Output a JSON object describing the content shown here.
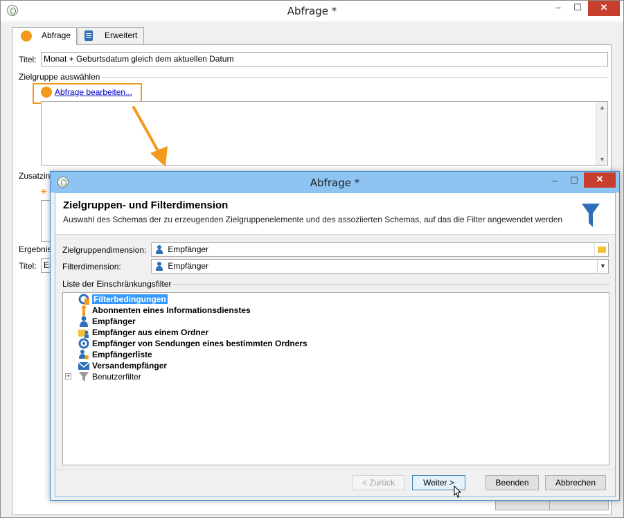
{
  "outer_window": {
    "title": "Abfrage *",
    "minimize_glyph": "–",
    "maximize_glyph": "☐",
    "close_glyph": "✕",
    "tabs": [
      {
        "label": "Abfrage",
        "icon": "orange-circle-icon"
      },
      {
        "label": "Erweitert",
        "icon": "clipboard-icon"
      }
    ],
    "title_label": "Titel:",
    "title_value": "Monat + Geburtsdatum gleich dem aktuellen Datum",
    "section_target": "Zielgruppe auswählen",
    "edit_query_link": "Abfrage bearbeiten...",
    "section_additional_partial": "Zusatzin",
    "section_result_partial": "Ergebnis",
    "title2_label": "Titel:",
    "title2_value_partial": "Er",
    "highlight_color": "#f39a1c"
  },
  "dialog": {
    "title": "Abfrage *",
    "minimize_glyph": "–",
    "maximize_glyph": "☐",
    "close_glyph": "✕",
    "heading": "Zielgruppen- und Filterdimension",
    "subheading": "Auswahl des Schemas der zu erzeugenden Zielgruppenelemente und des assoziierten Schemas, auf das die Filter angewendet werden",
    "target_dimension_label": "Zielgruppendimension:",
    "target_dimension_value": "Empfänger",
    "filter_dimension_label": "Filterdimension:",
    "filter_dimension_value": "Empfänger",
    "filter_list_label": "Liste der Einschränkungsfilter",
    "filter_items": [
      {
        "label": "Filterbedingungen",
        "icon": "filter-conditions-icon",
        "selected": true
      },
      {
        "label": "Abonnenten eines Informationsdienstes",
        "icon": "subscriber-icon"
      },
      {
        "label": "Empfänger",
        "icon": "person-icon"
      },
      {
        "label": "Empfänger aus einem Ordner",
        "icon": "folder-person-icon"
      },
      {
        "label": "Empfänger von Sendungen eines bestimmten Ordners",
        "icon": "delivery-recipients-icon"
      },
      {
        "label": "Empfängerliste",
        "icon": "recipient-list-icon"
      },
      {
        "label": "Versandempfänger",
        "icon": "envelope-icon"
      },
      {
        "label": "Benutzerfilter",
        "icon": "user-filter-icon",
        "expandable": true
      }
    ],
    "buttons": {
      "back": "< Zurück",
      "next": "Weiter >",
      "finish": "Beenden",
      "cancel": "Abbrechen"
    },
    "accent_color": "#2f6fb8"
  }
}
